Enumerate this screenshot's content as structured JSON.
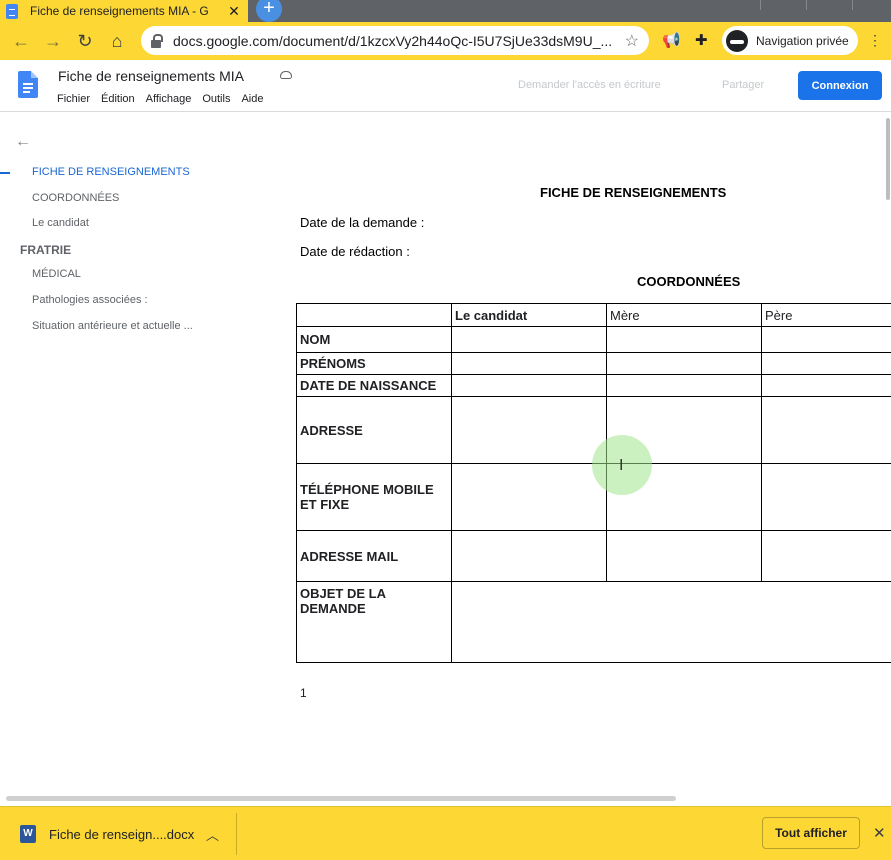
{
  "browser": {
    "tab_title": "Fiche de renseignements MIA - G",
    "tab_close": "✕",
    "new_tab": "+",
    "url": "docs.google.com/document/d/1kzcxVy2h44oQc-I5U7SjUe33dsM9U_...",
    "incognito_label": "Navigation privée",
    "accent": "#fdd835"
  },
  "docs": {
    "title": "Fiche de renseignements MIA",
    "menu": [
      "Fichier",
      "Édition",
      "Affichage",
      "Outils",
      "Aide"
    ],
    "request_edit": "Demander l'accès en écriture",
    "share": "Partager",
    "sign_in": "Connexion"
  },
  "outline": {
    "items": [
      {
        "label": "FICHE DE RENSEIGNEMENTS"
      },
      {
        "label": "COORDONNÉES"
      },
      {
        "label": "Le candidat"
      },
      {
        "label": "FRATRIE"
      },
      {
        "label": "MÉDICAL"
      },
      {
        "label": "Pathologies associées :"
      },
      {
        "label": "Situation antérieure et actuelle ..."
      }
    ]
  },
  "document": {
    "heading": "FICHE DE RENSEIGNEMENTS",
    "date_demande": "Date de la demande :",
    "date_redaction": "Date de rédaction :",
    "section": "COORDONNÉES",
    "table": {
      "headers": [
        "",
        "Le candidat",
        "Mère",
        "Père"
      ],
      "rows": [
        "NOM",
        "PRÉNOMS",
        "DATE DE NAISSANCE",
        "ADRESSE",
        "TÉLÉPHONE MOBILE ET FIXE",
        "ADRESSE MAIL",
        "OBJET DE LA DEMANDE"
      ]
    },
    "page_number": "1"
  },
  "download": {
    "file_name": "Fiche de renseign....docx",
    "show_all": "Tout afficher",
    "close": "✕"
  }
}
